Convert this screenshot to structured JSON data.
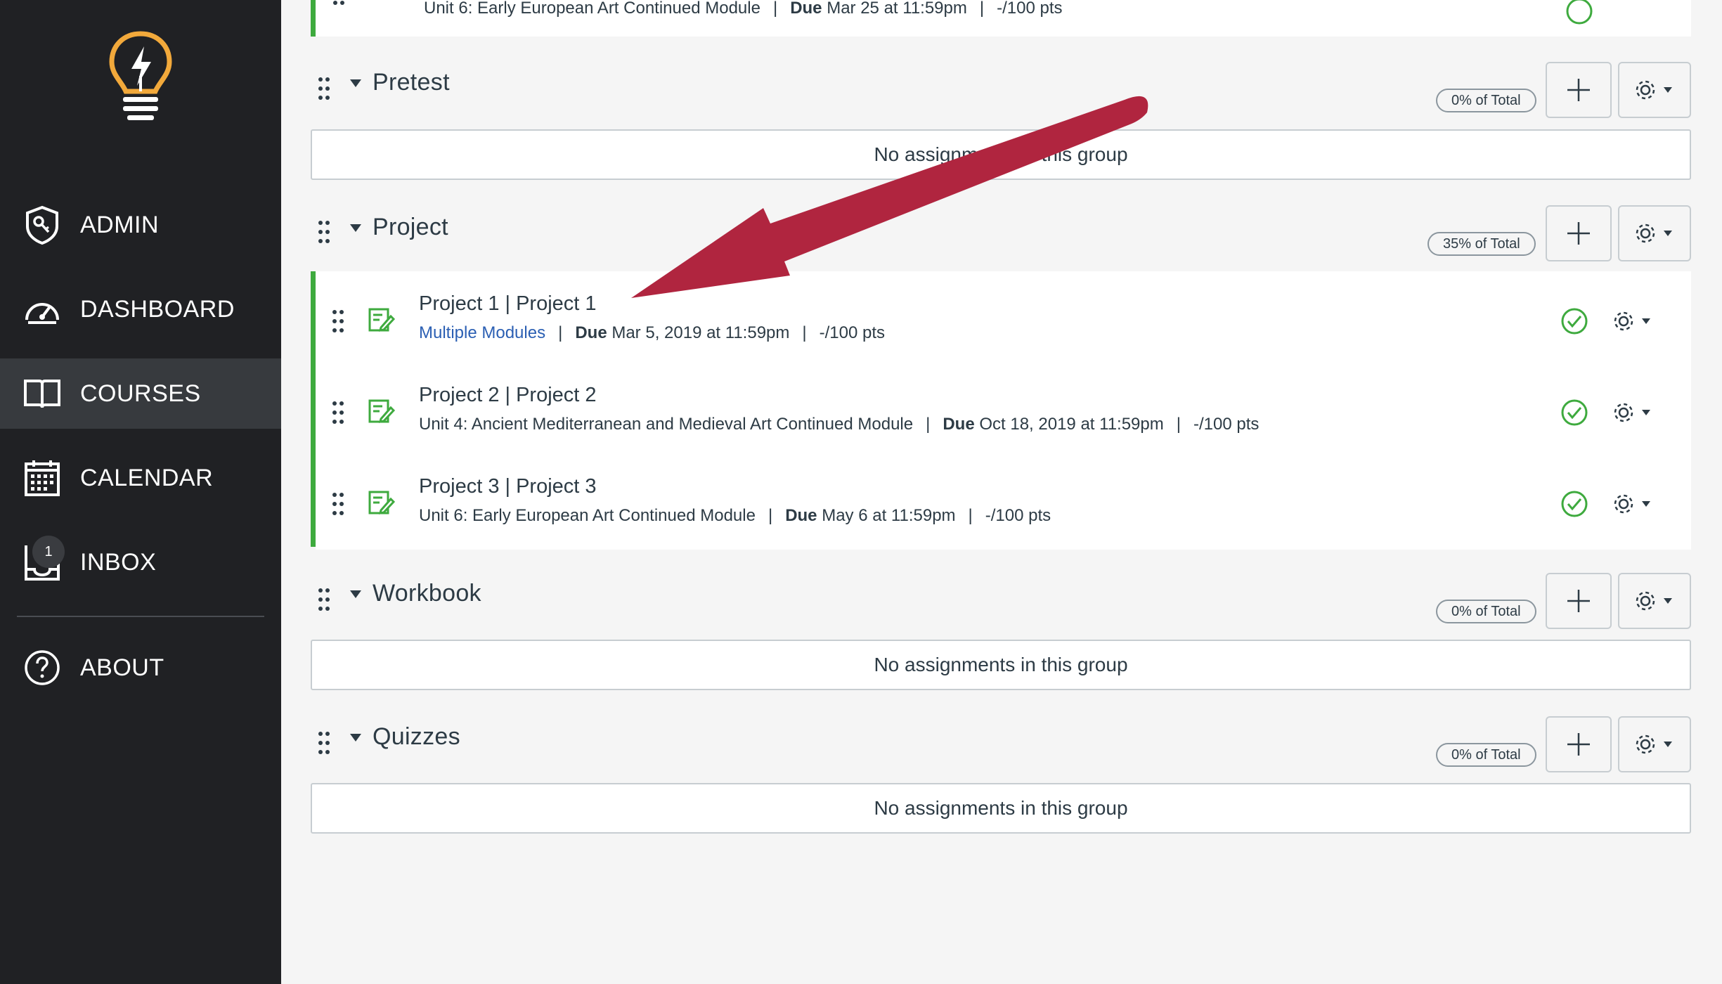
{
  "sidebar": {
    "items": [
      {
        "label": "ADMIN",
        "icon": "shield-key-icon"
      },
      {
        "label": "DASHBOARD",
        "icon": "speedometer-icon"
      },
      {
        "label": "COURSES",
        "icon": "book-icon"
      },
      {
        "label": "CALENDAR",
        "icon": "calendar-icon"
      },
      {
        "label": "INBOX",
        "icon": "inbox-icon",
        "badge": "1"
      },
      {
        "label": "ABOUT",
        "icon": "help-circle-icon"
      }
    ],
    "active": "COURSES"
  },
  "top_row": {
    "meta_module": "Unit 6: Early European Art Continued Module",
    "meta_due_label": "Due",
    "meta_due": "Mar 25 at 11:59pm",
    "meta_pts": "-/100 pts"
  },
  "groups": [
    {
      "title": "Pretest",
      "percent": "0% of Total",
      "empty_text": "No assignments in this group"
    },
    {
      "title": "Project",
      "percent": "35% of Total"
    },
    {
      "title": "Workbook",
      "percent": "0% of Total",
      "empty_text": "No assignments in this group"
    },
    {
      "title": "Quizzes",
      "percent": "0% of Total",
      "empty_text": "No assignments in this group"
    }
  ],
  "assignments": [
    {
      "title": "Project 1 | Project 1",
      "module": "Multiple Modules",
      "due_label": "Due",
      "due": "Mar 5, 2019 at 11:59pm",
      "pts": "-/100 pts"
    },
    {
      "title": "Project 2 | Project 2",
      "module": "Unit 4: Ancient Mediterranean and Medieval Art Continued Module",
      "due_label": "Due",
      "due": "Oct 18, 2019 at 11:59pm",
      "pts": "-/100 pts"
    },
    {
      "title": "Project 3 | Project 3",
      "module": "Unit 6: Early European Art Continued Module",
      "due_label": "Due",
      "due": "May 6 at 11:59pm",
      "pts": "-/100 pts"
    }
  ],
  "colors": {
    "sidebar_bg": "#202124",
    "active_nav": "#373a3e",
    "accent_green": "#3eaa3e",
    "link_blue": "#2b5fb3",
    "arrow": "#b0253f",
    "logo": "#f2a93b"
  }
}
